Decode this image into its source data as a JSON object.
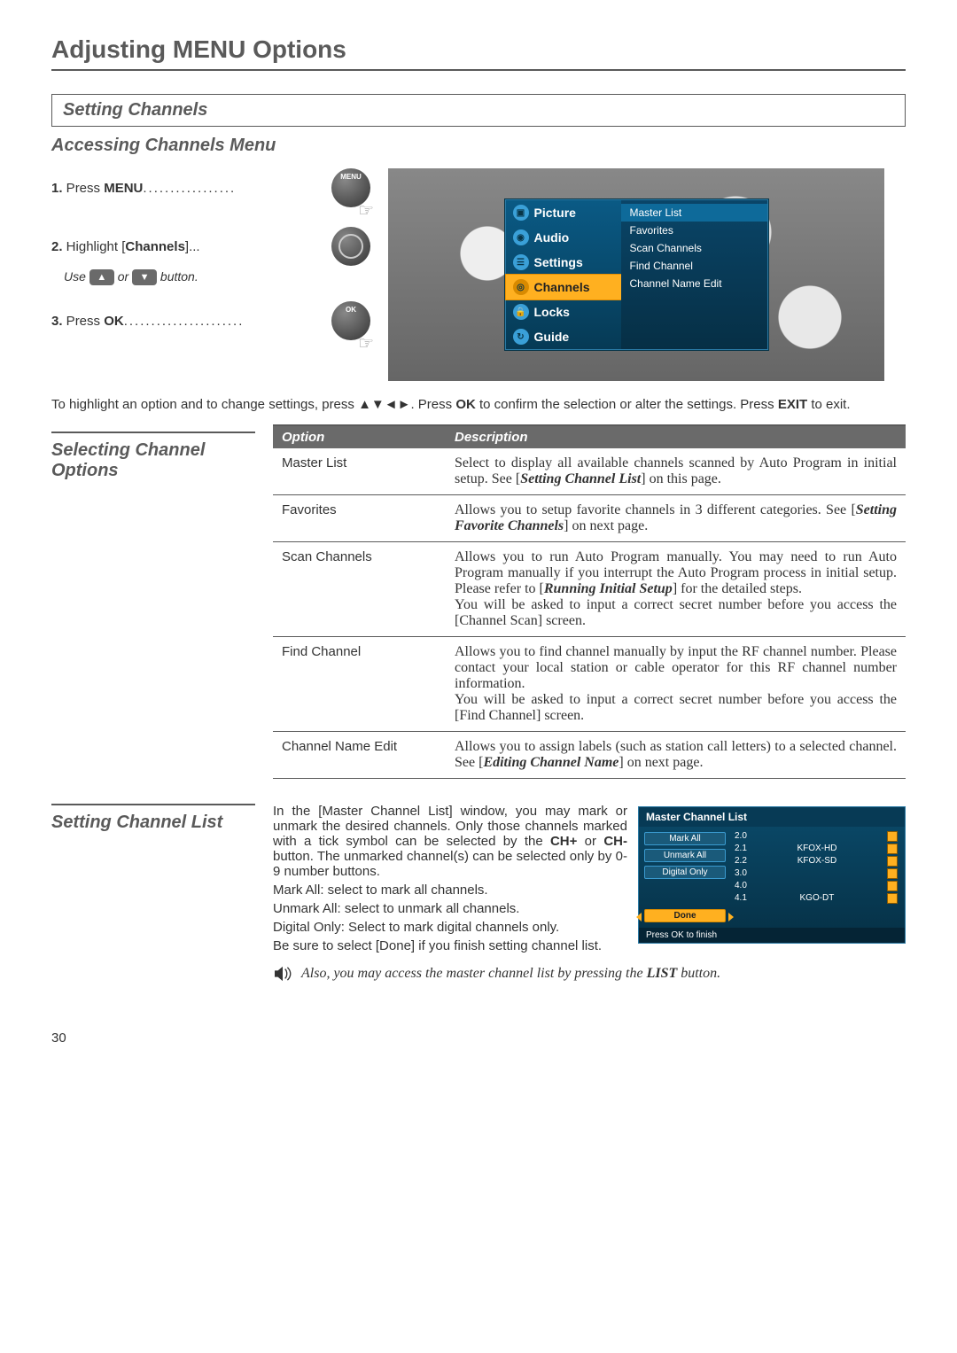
{
  "page_title": "Adjusting MENU Options",
  "section_title": "Setting Channels",
  "sub_heading": "Accessing Channels Menu",
  "steps": {
    "s1_num": "1.",
    "s1_pre": " Press ",
    "s1_bold": "MENU",
    "s1_dots": ".................",
    "s1_btn": "MENU",
    "s2_num": "2.",
    "s2_pre": " Highlight [",
    "s2_bold": "Channels",
    "s2_post": "]...",
    "s2_sub_pre": "Use ",
    "s2_sub_mid": " or ",
    "s2_sub_post": " button.",
    "s3_num": "3.",
    "s3_pre": " Press ",
    "s3_bold": "OK",
    "s3_dots": "......................",
    "s3_btn": "OK"
  },
  "osd": {
    "left": [
      "Picture",
      "Audio",
      "Settings",
      "Channels",
      "Locks",
      "Guide"
    ],
    "selected": "Channels",
    "right": [
      "Master List",
      "Favorites",
      "Scan Channels",
      "Find Channel",
      "Channel Name Edit"
    ]
  },
  "note_highlight": {
    "pre": "To highlight an option and to change settings, press ▲▼◄►. Press ",
    "b1": "OK",
    "mid": " to confirm the selection or alter the settings. Press ",
    "b2": "EXIT",
    "post": " to exit."
  },
  "opts_heading": "Selecting Channel Options",
  "opts_header": {
    "c1": "Option",
    "c2": "Description"
  },
  "opts": {
    "r0": {
      "name": "Master List",
      "d1": "Select to display all available channels scanned by Auto Program in initial setup. See [",
      "ref": "Setting Channel List",
      "d2": "] on this page."
    },
    "r1": {
      "name": "Favorites",
      "d1": "Allows you to setup favorite channels in 3 different categories. See [",
      "ref": "Setting Favorite Channels",
      "d2": "] on next page."
    },
    "r2": {
      "name": "Scan Channels",
      "d1": "Allows you to run Auto Program manually. You may need to run Auto Program manually if you interrupt the Auto Program process in initial setup. Please refer to [",
      "ref": "Running Initial Setup",
      "d2": "] for the detailed steps.",
      "d3": "You will be asked to input a correct secret number before you access the [Channel Scan] screen."
    },
    "r3": {
      "name": "Find Channel",
      "d1": "Allows you to find channel manually by input the RF channel number. Please contact your local station or cable operator for this RF channel number information.",
      "d3": "You will be asked to input a correct secret number before you access the [Find Channel] screen."
    },
    "r4": {
      "name": "Channel Name Edit",
      "d1": "Allows you to assign labels (such as station call letters) to a selected channel. See [",
      "ref": "Editing Channel Name",
      "d2": "] on next page."
    }
  },
  "chlist": {
    "heading": "Setting Channel List",
    "p1a": "In the [Master Channel List] window, you may mark or unmark the desired channels. Only those channels marked with a tick symbol can be selected by the ",
    "p1b1": "CH+",
    "p1mid": " or ",
    "p1b2": "CH-",
    "p1c": " button. The unmarked channel(s) can be selected only by 0-9 number buttons.",
    "p2": "Mark All: select to mark all channels.",
    "p3": "Unmark All: select to unmark all channels.",
    "p4": "Digital Only: Select to mark digital channels only.",
    "p5": "Be sure to select [Done] if you finish setting channel list."
  },
  "mcl": {
    "title": "Master Channel List",
    "btns": [
      "Mark All",
      "Unmark All",
      "Digital Only"
    ],
    "done": "Done",
    "rows": [
      {
        "num": "2.0",
        "name": ""
      },
      {
        "num": "2.1",
        "name": "KFOX-HD"
      },
      {
        "num": "2.2",
        "name": "KFOX-SD"
      },
      {
        "num": "3.0",
        "name": ""
      },
      {
        "num": "4.0",
        "name": ""
      },
      {
        "num": "4.1",
        "name": "KGO-DT"
      }
    ],
    "footer": "Press OK to finish"
  },
  "sound_note": {
    "pre": "Also, you may access the master channel list by pressing  the ",
    "bold": "LIST",
    "post": " button."
  },
  "page_number": "30"
}
